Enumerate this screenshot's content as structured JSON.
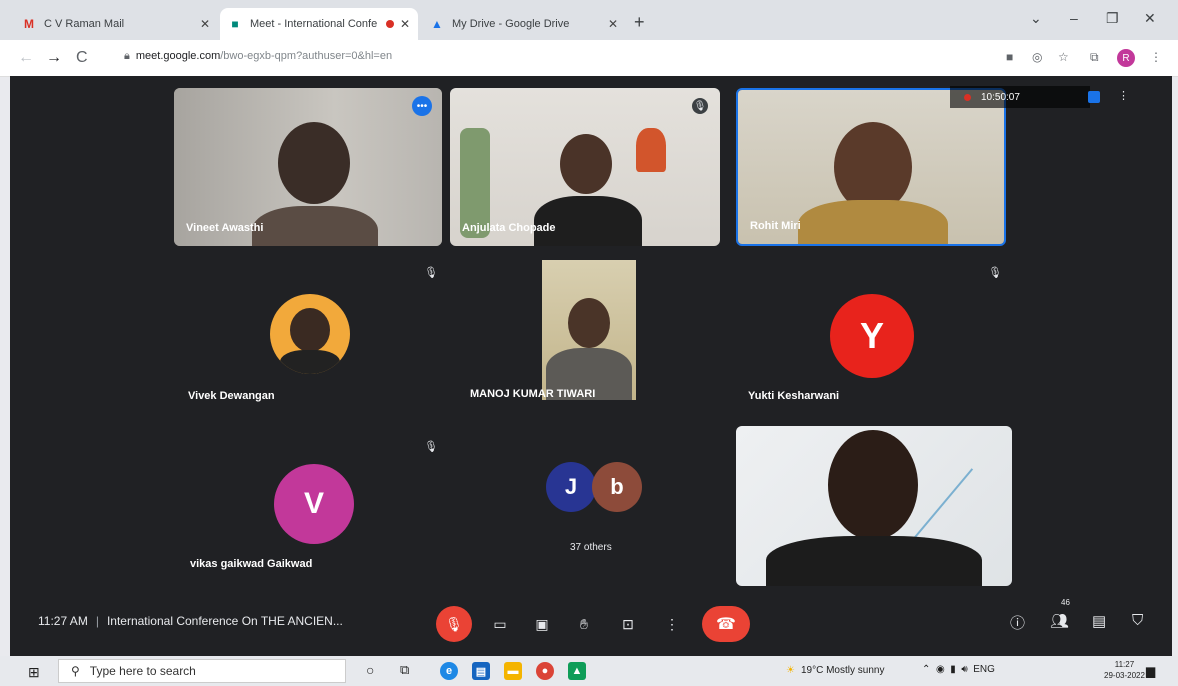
{
  "browser": {
    "tabs": [
      {
        "title": "C V Raman Mail",
        "active": false
      },
      {
        "title": "Meet - International Confe",
        "active": true
      },
      {
        "title": "My Drive - Google Drive",
        "active": false
      }
    ],
    "url_host": "meet.google.com",
    "url_path": "/bwo-egxb-qpm?authuser=0&hl=en"
  },
  "meet": {
    "recording_timer": "10:50:07",
    "participants": [
      {
        "name": "Vineet Awasthi"
      },
      {
        "name": "Anjulata Chopade"
      },
      {
        "name": "Rohit Miri"
      },
      {
        "name": "Vivek Dewangan"
      },
      {
        "name": "MANOJ KUMAR TIWARI"
      },
      {
        "name": "Yukti Kesharwani",
        "initial": "Y"
      },
      {
        "name": "vikas gaikwad Gaikwad",
        "initial": "V"
      }
    ],
    "others_initials": [
      "J",
      "b"
    ],
    "others_label": "37 others",
    "time": "11:27 AM",
    "meeting_title": "International Conference On THE ANCIEN...",
    "participant_count": "46"
  },
  "taskbar": {
    "search_placeholder": "Type here to search",
    "weather": "19°C  Mostly sunny",
    "lang": "ENG",
    "clock_time": "11:27",
    "clock_date": "29-03-2022"
  },
  "colors": {
    "meet_bg": "#202124",
    "red": "#ea4335",
    "avatar_yukti": "#e8231c",
    "avatar_vikas": "#c2389a",
    "avatar_j": "#283593",
    "avatar_b": "#8d4b3a"
  }
}
